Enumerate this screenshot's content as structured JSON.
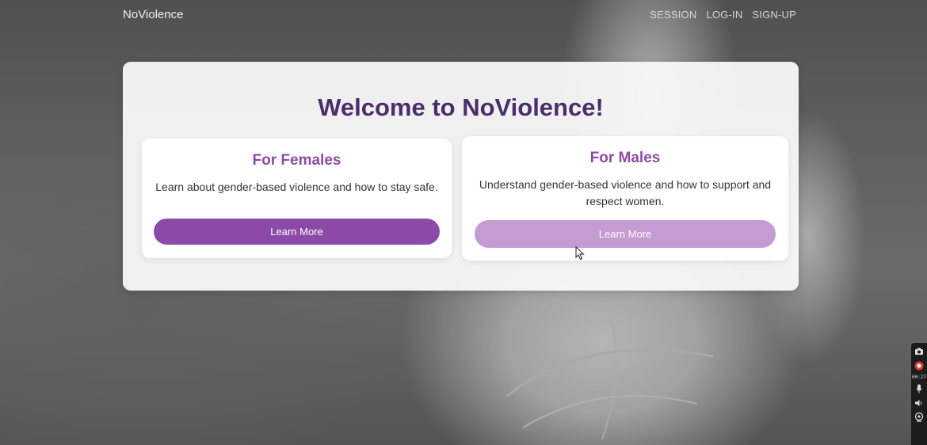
{
  "nav": {
    "brand": "NoViolence",
    "links": [
      "SESSION",
      "LOG-IN",
      "SIGN-UP"
    ]
  },
  "main": {
    "title": "Welcome to NoViolence!",
    "cards": [
      {
        "title": "For Females",
        "text": "Learn about gender-based violence and how to stay safe.",
        "button": "Learn More"
      },
      {
        "title": "For Males",
        "text": "Understand gender-based violence and how to support and respect women.",
        "button": "Learn More"
      }
    ]
  },
  "recorder": {
    "time": "00:27"
  },
  "colors": {
    "accent": "#8c4aa8",
    "accent_hover": "#c49bd3",
    "title": "#4a2d6a"
  }
}
